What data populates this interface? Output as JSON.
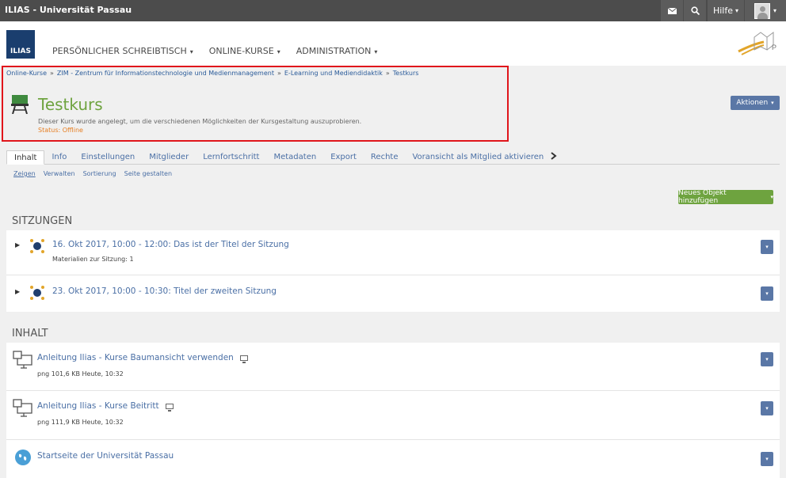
{
  "topbar": {
    "brand": "ILIAS - Universität Passau",
    "help_label": "Hilfe",
    "mail_icon": "envelope-icon",
    "search_icon": "search-icon",
    "caret": "▾"
  },
  "header": {
    "logo_text": "ILIAS",
    "nav": [
      {
        "label": "PERSÖNLICHER SCHREIBTISCH"
      },
      {
        "label": "ONLINE-KURSE"
      },
      {
        "label": "ADMINISTRATION"
      }
    ],
    "caret": "▾"
  },
  "breadcrumb": {
    "items": [
      "Online-Kurse",
      "ZIM - Zentrum für Informationstechnologie und Medienmanagement",
      "E-Learning und Mediendidaktik",
      "Testkurs"
    ],
    "separator": "»"
  },
  "course": {
    "title": "Testkurs",
    "description": "Dieser Kurs wurde angelegt, um die verschiedenen Möglichkeiten der Kursgestaltung auszuprobieren.",
    "status": "Status: Offline"
  },
  "actions_button": "Aktionen",
  "tabs": [
    {
      "label": "Inhalt",
      "active": true
    },
    {
      "label": "Info"
    },
    {
      "label": "Einstellungen"
    },
    {
      "label": "Mitglieder"
    },
    {
      "label": "Lernfortschritt"
    },
    {
      "label": "Metadaten"
    },
    {
      "label": "Export"
    },
    {
      "label": "Rechte"
    },
    {
      "label": "Voransicht als Mitglied aktivieren"
    }
  ],
  "subtabs": [
    {
      "label": "Zeigen",
      "selected": true
    },
    {
      "label": "Verwalten"
    },
    {
      "label": "Sortierung"
    },
    {
      "label": "Seite gestalten"
    }
  ],
  "add_object_button": "Neues Objekt hinzufügen",
  "sessions": {
    "heading": "SITZUNGEN",
    "items": [
      {
        "title": "16. Okt 2017, 10:00 - 12:00: Das ist der Titel der Sitzung",
        "meta": "Materialien zur Sitzung: 1"
      },
      {
        "title": "23. Okt 2017, 10:00 - 10:30: Titel der zweiten Sitzung",
        "meta": ""
      }
    ]
  },
  "content": {
    "heading": "INHALT",
    "items": [
      {
        "title": "Anleitung Ilias - Kurse Baumansicht verwenden",
        "meta": "png   101,6 KB   Heute, 10:32",
        "icon": "file-icon"
      },
      {
        "title": "Anleitung Ilias - Kurse Beitritt",
        "meta": "png   111,9 KB   Heute, 10:32",
        "icon": "file-icon"
      },
      {
        "title": "Startseite der Universität Passau",
        "meta": "",
        "icon": "weblink-icon"
      }
    ]
  },
  "colors": {
    "topbar": "#4c4c4c",
    "primary_button": "#5a77a6",
    "green": "#6ea33f",
    "highlight_border": "#e0151b",
    "status_offline": "#e67e22"
  }
}
